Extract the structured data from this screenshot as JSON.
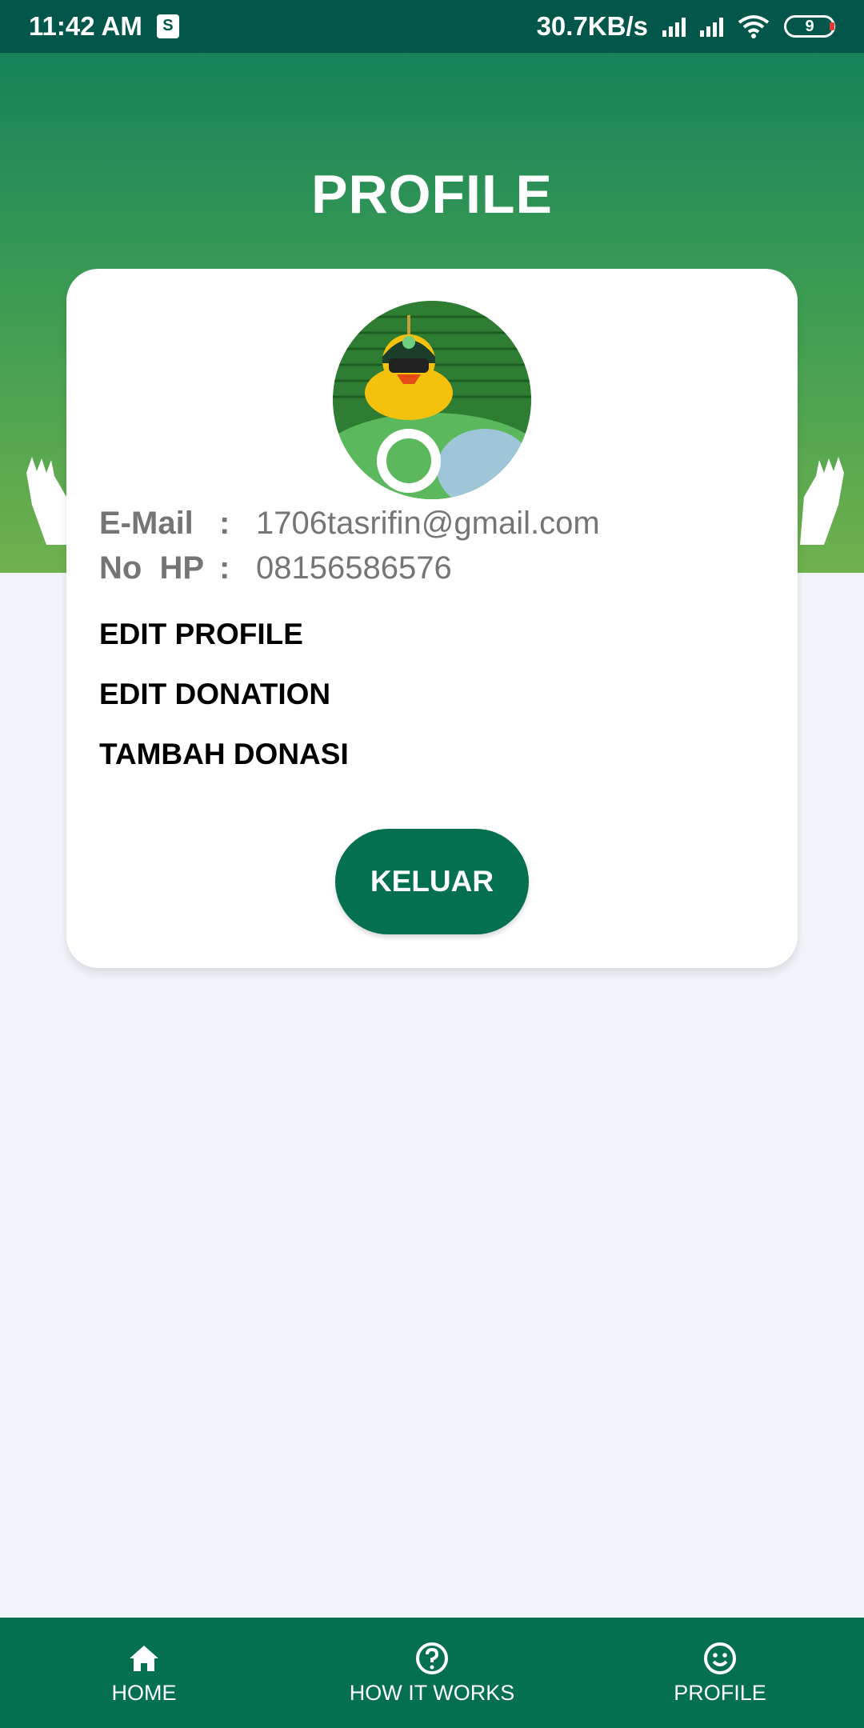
{
  "status_bar": {
    "time": "11:42 AM",
    "network_speed": "30.7KB/s",
    "battery_level": "9",
    "icons": [
      "shopee-bag-icon",
      "signal-icon",
      "signal-icon",
      "wifi-icon",
      "battery-icon"
    ]
  },
  "header": {
    "title": "PROFILE"
  },
  "profile": {
    "email_label": "E-Mail",
    "email_colon": ":",
    "email_value": "1706tasrifin@gmail.com",
    "phone_label": "No  HP",
    "phone_colon": ":",
    "phone_value": "08156586576"
  },
  "menu": {
    "edit_profile": "EDIT PROFILE",
    "edit_donation": "EDIT DONATION",
    "add_donation": "TAMBAH DONASI"
  },
  "logout_label": "KELUAR",
  "bottom_nav": {
    "items": [
      {
        "label": "HOME",
        "icon": "home-icon"
      },
      {
        "label": "HOW IT WORKS",
        "icon": "help-circle-icon"
      },
      {
        "label": "PROFILE",
        "icon": "smiley-icon"
      }
    ]
  },
  "colors": {
    "status_bar": "#02574a",
    "primary": "#04704f",
    "gradient_top": "#17825a",
    "gradient_bottom": "#6fb14d",
    "background": "#f0f3f8"
  }
}
